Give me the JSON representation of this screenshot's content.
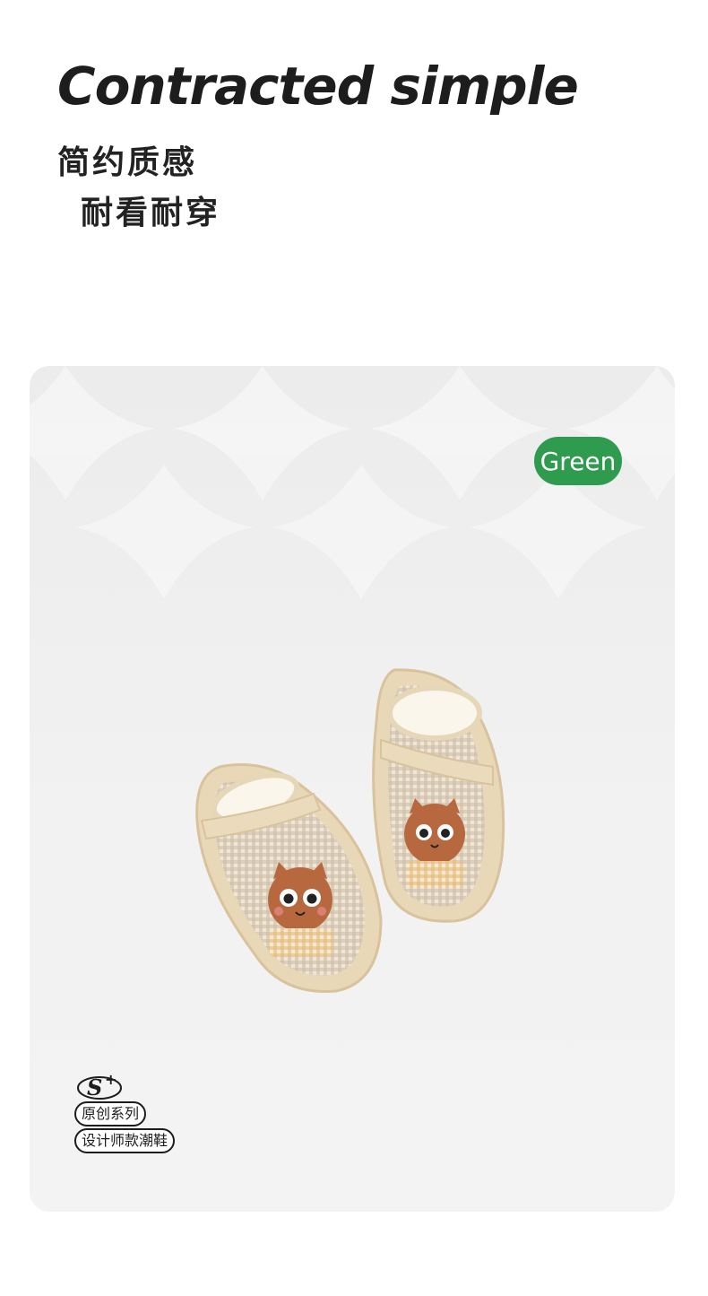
{
  "headline": "Contracted simple",
  "subtitle_line1": "简约质感",
  "subtitle_line2": "耐看耐穿",
  "color_badge": {
    "label": "Green",
    "color": "#2e9b4e"
  },
  "brand": {
    "logo_text": "S+",
    "line1": "原创系列",
    "line2": "设计师款潮鞋"
  },
  "product": {
    "image": "pair of beige gingham baby sandals with embroidered cat faces"
  }
}
